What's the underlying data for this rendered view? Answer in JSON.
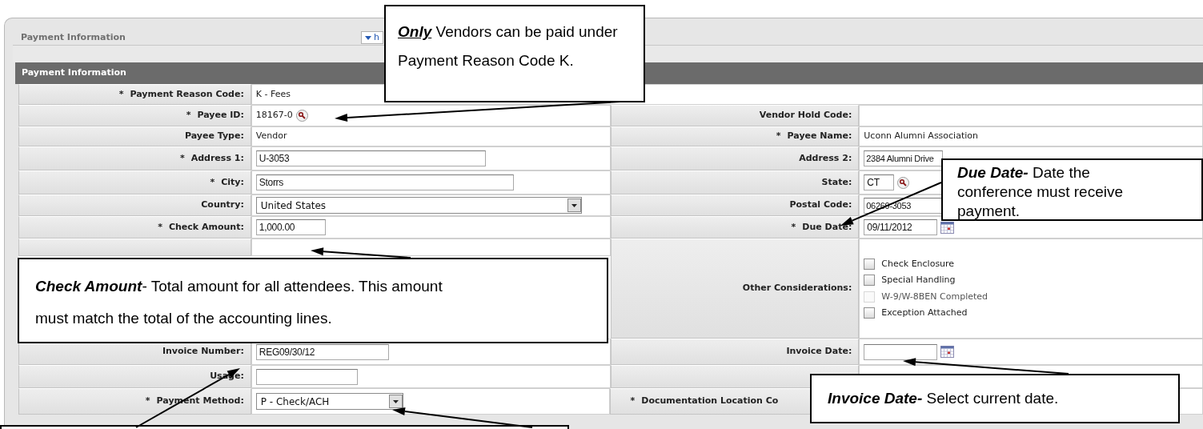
{
  "panel": {
    "title": "Payment Information",
    "toggle": "h"
  },
  "section": {
    "title": "Payment Information"
  },
  "rows": [
    {
      "left": {
        "label": "Payment Reason Code:",
        "mark": "*",
        "kind": "text",
        "value": "K - Fees"
      }
    },
    {
      "left": {
        "label": "Payee ID:",
        "mark": "*",
        "kind": "text_lookup",
        "value": "18167-0"
      },
      "right": {
        "label": "Vendor Hold Code:",
        "kind": "text"
      }
    },
    {
      "left": {
        "label": "Payee Type:",
        "kind": "text",
        "value": "Vendor"
      },
      "right": {
        "label": "Payee Name:",
        "mark": "*",
        "kind": "text",
        "value": "Uconn Alumni Association"
      }
    },
    {
      "left": {
        "label": "Address 1:",
        "mark": "*",
        "kind": "input",
        "value": "U-3053"
      },
      "right": {
        "label": "Address 2:",
        "kind": "input",
        "value": "2384 Alumni Drive"
      }
    },
    {
      "left": {
        "label": "City:",
        "mark": "*",
        "kind": "input",
        "value": "Storrs"
      },
      "right": {
        "label": "State:",
        "kind": "input_lookup",
        "value": "CT"
      }
    },
    {
      "left": {
        "label": "Country:",
        "kind": "select",
        "value": "United States"
      },
      "right": {
        "label": "Postal Code:",
        "kind": "input",
        "value": "06269-3053"
      }
    },
    {
      "left": {
        "label": "Check Amount:",
        "mark": "*",
        "kind": "input",
        "value": "1,000.00"
      },
      "right": {
        "label": "Due Date:",
        "mark": "*",
        "kind": "date",
        "value": "09/11/2012"
      }
    },
    {
      "left": {
        "kind": "blank"
      },
      "right": {
        "label": "Other Considerations:",
        "kind": "checkboxes",
        "options": [
          {
            "label": "Check Enclosure",
            "checked": false,
            "disabled": false
          },
          {
            "label": "Special Handling",
            "checked": false,
            "disabled": false
          },
          {
            "label": "W-9/W-8BEN Completed",
            "checked": false,
            "disabled": true
          },
          {
            "label": "Exception Attached",
            "checked": false,
            "disabled": false
          }
        ]
      }
    },
    {
      "left": {
        "label": "Invoice Number:",
        "kind": "input",
        "value": "REG09/30/12"
      },
      "right": {
        "label": "Invoice Date:",
        "kind": "date"
      }
    },
    {
      "left": {
        "label": "Usage:",
        "kind": "input"
      },
      "right": {
        "kind": "blank"
      }
    },
    {
      "left": {
        "label": "Payment Method:",
        "mark": "*",
        "kind": "select",
        "value": "P - Check/ACH"
      },
      "right": {
        "label": "Documentation Location Co",
        "mark": "*",
        "kind": "blank"
      }
    }
  ],
  "callouts": [
    {
      "text": "*Only* Vendors can be paid under Payment Reason Code K.",
      "underline": true
    },
    {
      "text": "*Due Date-* Date the conference must receive payment.",
      "underline": false
    },
    {
      "text": "*Check Amount*- Total amount for all attendees. This amount must match the total of the accounting lines.",
      "underline": false
    },
    {
      "text": "*Invoice Date-* Select current date.",
      "underline": false
    }
  ]
}
